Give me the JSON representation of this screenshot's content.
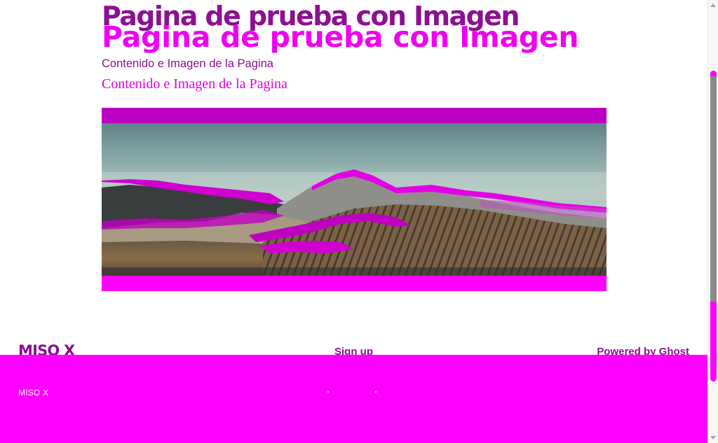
{
  "page": {
    "title": "Pagina de prueba con Imagen",
    "title_overlay": "Pagina de prueba con Imagen",
    "subtitle": "Contenido e Imagen de la Pagina",
    "subtitle_overlay": "Contenido e Imagen de la Pagina"
  },
  "image": {
    "subject": "volcano-landscape",
    "colors": {
      "band_top": "#bb00c4",
      "band_bottom": "#ff00ff",
      "sky": "#8fb2b0",
      "magenta_overlay": "#e000e0"
    }
  },
  "footer": {
    "brand": "MISO X",
    "signup_label": "Sign up",
    "powered_prefix": "Powered by ",
    "powered_link": "Ghost",
    "band_brand": "MISO X"
  },
  "colors": {
    "accent_dark": "#8d0f93",
    "accent_bright": "#ff00ff"
  },
  "icons": {
    "scroll_up": "scroll-up-arrow-icon",
    "scroll_down": "scroll-down-arrow-icon"
  }
}
